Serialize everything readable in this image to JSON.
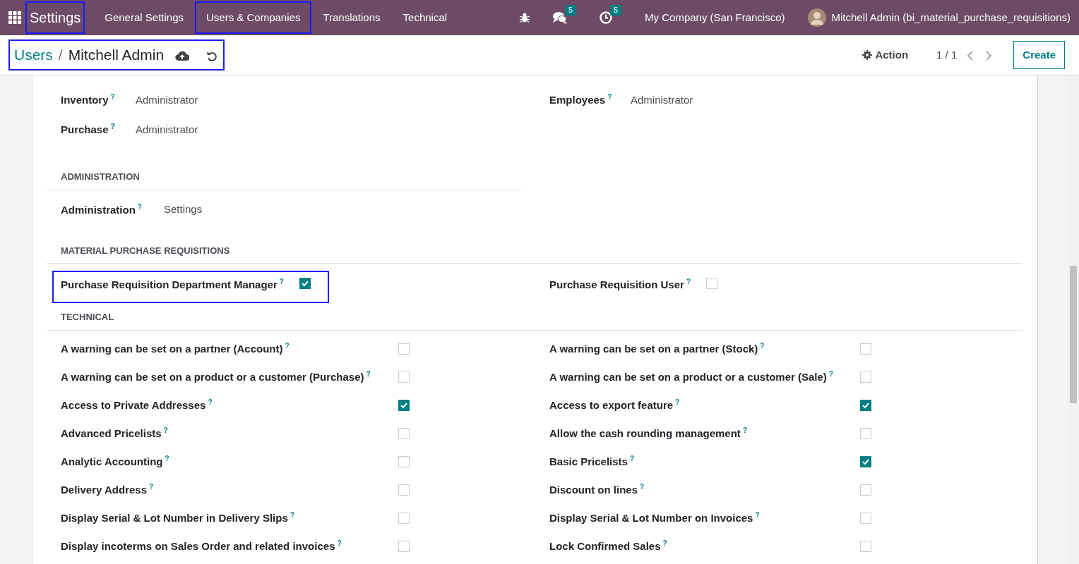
{
  "navbar": {
    "app": {
      "label": "Settings",
      "highlighted": true
    },
    "menu": [
      {
        "label": "General Settings",
        "highlighted": false
      },
      {
        "label": "Users & Companies",
        "highlighted": true
      },
      {
        "label": "Translations",
        "highlighted": false
      },
      {
        "label": "Technical",
        "highlighted": false
      }
    ],
    "messages_count": "5",
    "activities_count": "5",
    "company": "My Company (San Francisco)",
    "user": "Mitchell Admin (bi_material_purchase_requisitions)"
  },
  "control_panel": {
    "breadcrumb": {
      "parent": "Users",
      "separator": "/",
      "current": "Mitchell Admin",
      "highlighted": true
    },
    "action": "Action",
    "pager": "1 / 1",
    "create": "Create"
  },
  "access_rights": [
    {
      "left": {
        "label": "Inventory",
        "help": "?",
        "value": "Administrator"
      },
      "right": {
        "label": "Employees",
        "help": "?",
        "value": "Administrator"
      }
    },
    {
      "left": {
        "label": "Purchase",
        "help": "?",
        "value": "Administrator"
      }
    }
  ],
  "administration": {
    "title": "ADMINISTRATION",
    "fields": [
      {
        "label": "Administration",
        "help": "?",
        "value": "Settings"
      }
    ]
  },
  "material_purchase_requisitions": {
    "title": "MATERIAL PURCHASE REQUISITIONS",
    "fields": [
      {
        "label": "Purchase Requisition Department Manager",
        "help": "?",
        "checked": true,
        "highlighted": true
      },
      {
        "label": "Purchase Requisition User",
        "help": "?",
        "checked": false,
        "highlighted": false
      }
    ]
  },
  "technical": {
    "title": "TECHNICAL",
    "fields": [
      {
        "label": "A warning can be set on a partner (Account)",
        "help": "?",
        "checked": false
      },
      {
        "label": "A warning can be set on a partner (Stock)",
        "help": "?",
        "checked": false
      },
      {
        "label": "A warning can be set on a product or a customer (Purchase)",
        "help": "?",
        "checked": false
      },
      {
        "label": "A warning can be set on a product or a customer (Sale)",
        "help": "?",
        "checked": false
      },
      {
        "label": "Access to Private Addresses",
        "help": "?",
        "checked": true
      },
      {
        "label": "Access to export feature",
        "help": "?",
        "checked": true
      },
      {
        "label": "Advanced Pricelists",
        "help": "?",
        "checked": false
      },
      {
        "label": "Allow the cash rounding management",
        "help": "?",
        "checked": false
      },
      {
        "label": "Analytic Accounting",
        "help": "?",
        "checked": false
      },
      {
        "label": "Basic Pricelists",
        "help": "?",
        "checked": true
      },
      {
        "label": "Delivery Address",
        "help": "?",
        "checked": false
      },
      {
        "label": "Discount on lines",
        "help": "?",
        "checked": false
      },
      {
        "label": "Display Serial & Lot Number in Delivery Slips",
        "help": "?",
        "checked": false
      },
      {
        "label": "Display Serial & Lot Number on Invoices",
        "help": "?",
        "checked": false
      },
      {
        "label": "Display incoterms on Sales Order and related invoices",
        "help": "?",
        "checked": false
      },
      {
        "label": "Lock Confirmed Sales",
        "help": "?",
        "checked": false
      }
    ]
  }
}
